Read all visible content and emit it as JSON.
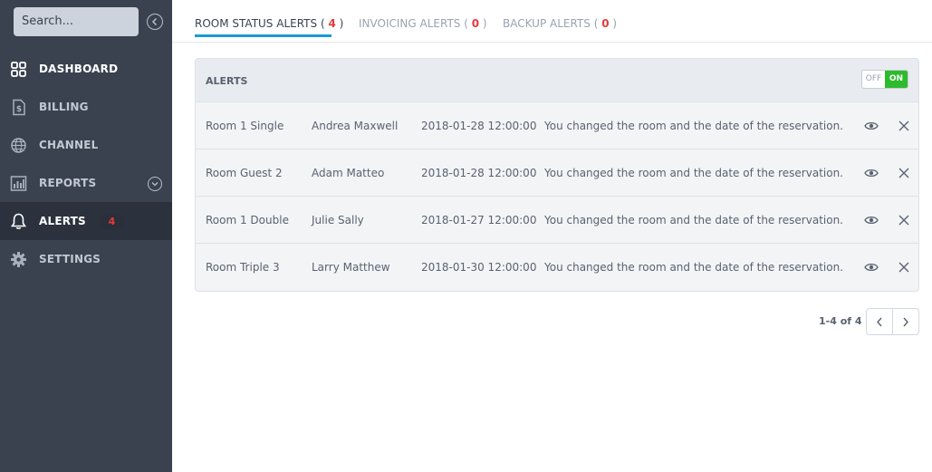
{
  "sidebar": {
    "search_placeholder": "Search...",
    "items": [
      {
        "label": "DASHBOARD",
        "icon": "dashboard-icon"
      },
      {
        "label": "BILLING",
        "icon": "billing-icon"
      },
      {
        "label": "CHANNEL",
        "icon": "globe-icon"
      },
      {
        "label": "REPORTS",
        "icon": "reports-icon"
      },
      {
        "label": "ALERTS",
        "icon": "bell-icon",
        "badge": "4"
      },
      {
        "label": "SETTINGS",
        "icon": "gear-icon"
      }
    ]
  },
  "tabs": [
    {
      "label": "ROOM STATUS ALERTS",
      "count": "4"
    },
    {
      "label": "INVOICING ALERTS",
      "count": "0"
    },
    {
      "label": "BACKUP ALERTS",
      "count": "0"
    }
  ],
  "panel": {
    "title": "ALERTS",
    "toggle_off": "OFF",
    "toggle_on": "ON",
    "rows": [
      {
        "room": "Room 1 Single",
        "name": "Andrea Maxwell",
        "date": "2018-01-28 12:00:00",
        "message": "You changed the room and the date of the reservation."
      },
      {
        "room": "Room Guest 2",
        "name": "Adam Matteo",
        "date": "2018-01-28 12:00:00",
        "message": "You changed the room and the date of the reservation."
      },
      {
        "room": "Room 1 Double",
        "name": "Julie Sally",
        "date": "2018-01-27 12:00:00",
        "message": "You changed the room and the date of the reservation."
      },
      {
        "room": "Room Triple 3",
        "name": "Larry Matthew",
        "date": "2018-01-30 12:00:00",
        "message": "You changed the room and the date of the reservation."
      }
    ]
  },
  "pagination": {
    "text": "1-4 of 4"
  },
  "colors": {
    "sidebar_bg": "#3a4250",
    "active_tab_underline": "#1b9ad6",
    "count_red": "#e23b3b",
    "toggle_on_green": "#2dbb2d"
  }
}
